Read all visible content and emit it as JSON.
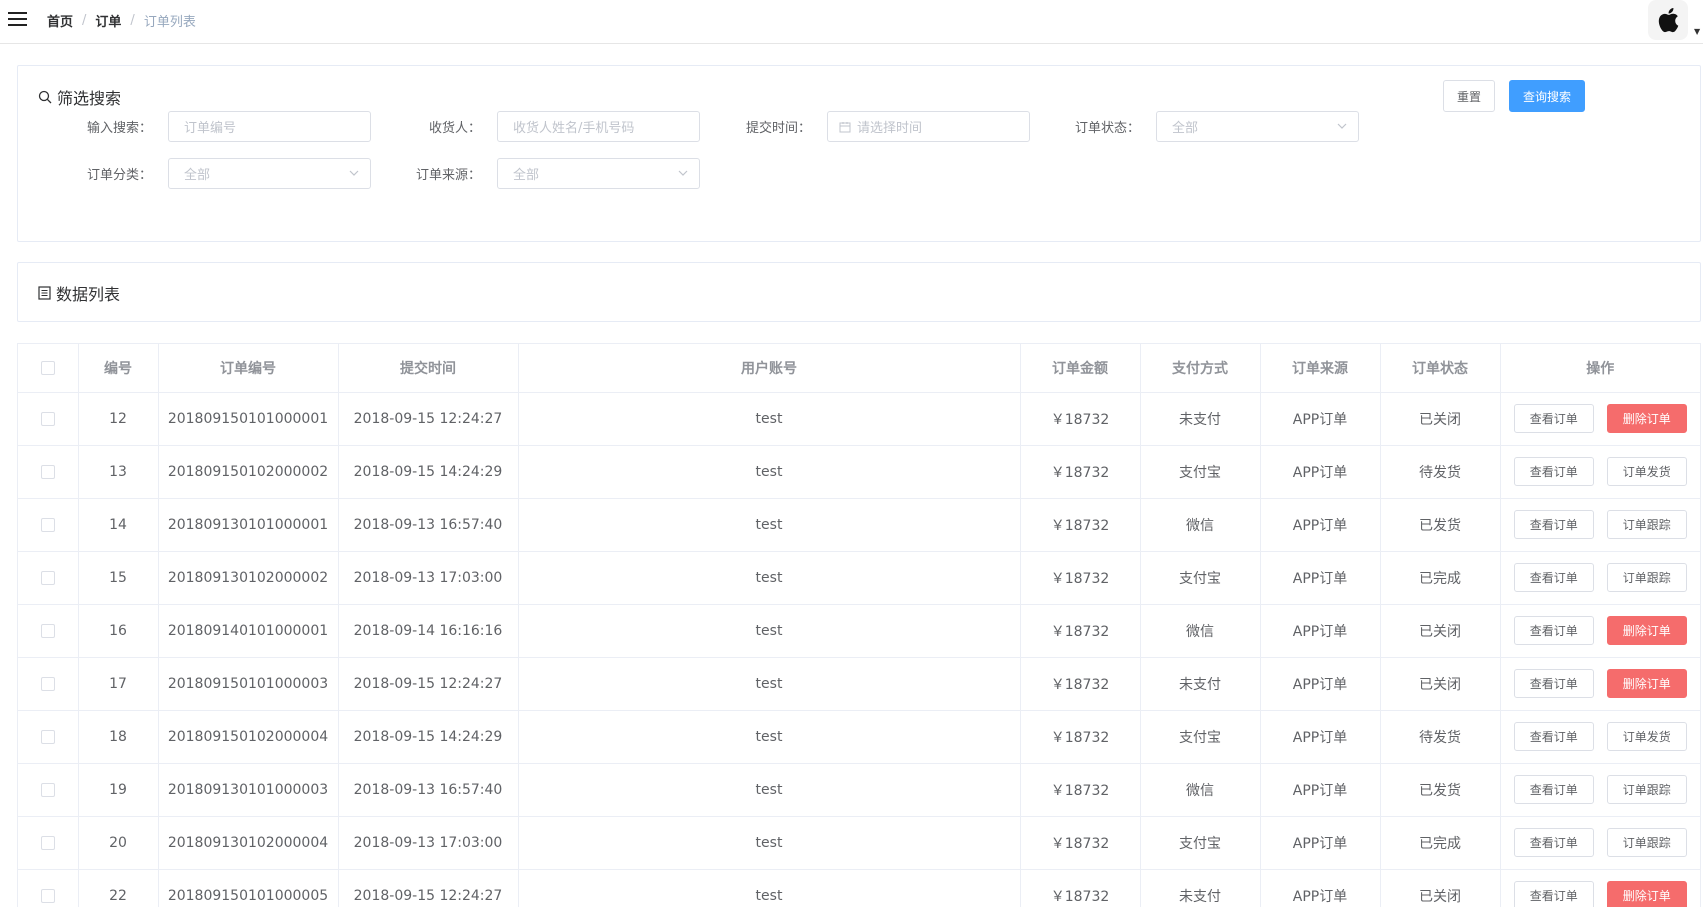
{
  "navbar": {
    "breadcrumb": [
      "首页",
      "订单",
      "订单列表"
    ],
    "separator": "/"
  },
  "filter": {
    "title": "筛选搜索",
    "reset_label": "重置",
    "search_label": "查询搜索",
    "fields": {
      "keyword": {
        "label": "输入搜索：",
        "placeholder": "订单编号"
      },
      "receiver": {
        "label": "收货人：",
        "placeholder": "收货人姓名/手机号码"
      },
      "submit_time": {
        "label": "提交时间：",
        "placeholder": "请选择时间"
      },
      "status": {
        "label": "订单状态：",
        "value": "全部"
      },
      "category": {
        "label": "订单分类：",
        "value": "全部"
      },
      "source": {
        "label": "订单来源：",
        "value": "全部"
      }
    }
  },
  "list": {
    "title": "数据列表"
  },
  "table": {
    "headers": [
      "编号",
      "订单编号",
      "提交时间",
      "用户账号",
      "订单金额",
      "支付方式",
      "订单来源",
      "订单状态",
      "操作"
    ],
    "rows": [
      {
        "id": "12",
        "order_no": "201809150101000001",
        "time": "2018-09-15 12:24:27",
        "user": "test",
        "amount": "￥18732",
        "pay": "未支付",
        "source": "APP订单",
        "status": "已关闭",
        "op1": "查看订单",
        "op2": "删除订单",
        "op2_type": "danger"
      },
      {
        "id": "13",
        "order_no": "201809150102000002",
        "time": "2018-09-15 14:24:29",
        "user": "test",
        "amount": "￥18732",
        "pay": "支付宝",
        "source": "APP订单",
        "status": "待发货",
        "op1": "查看订单",
        "op2": "订单发货",
        "op2_type": "default"
      },
      {
        "id": "14",
        "order_no": "201809130101000001",
        "time": "2018-09-13 16:57:40",
        "user": "test",
        "amount": "￥18732",
        "pay": "微信",
        "source": "APP订单",
        "status": "已发货",
        "op1": "查看订单",
        "op2": "订单跟踪",
        "op2_type": "default"
      },
      {
        "id": "15",
        "order_no": "201809130102000002",
        "time": "2018-09-13 17:03:00",
        "user": "test",
        "amount": "￥18732",
        "pay": "支付宝",
        "source": "APP订单",
        "status": "已完成",
        "op1": "查看订单",
        "op2": "订单跟踪",
        "op2_type": "default"
      },
      {
        "id": "16",
        "order_no": "201809140101000001",
        "time": "2018-09-14 16:16:16",
        "user": "test",
        "amount": "￥18732",
        "pay": "微信",
        "source": "APP订单",
        "status": "已关闭",
        "op1": "查看订单",
        "op2": "删除订单",
        "op2_type": "danger"
      },
      {
        "id": "17",
        "order_no": "201809150101000003",
        "time": "2018-09-15 12:24:27",
        "user": "test",
        "amount": "￥18732",
        "pay": "未支付",
        "source": "APP订单",
        "status": "已关闭",
        "op1": "查看订单",
        "op2": "删除订单",
        "op2_type": "danger"
      },
      {
        "id": "18",
        "order_no": "201809150102000004",
        "time": "2018-09-15 14:24:29",
        "user": "test",
        "amount": "￥18732",
        "pay": "支付宝",
        "source": "APP订单",
        "status": "待发货",
        "op1": "查看订单",
        "op2": "订单发货",
        "op2_type": "default"
      },
      {
        "id": "19",
        "order_no": "201809130101000003",
        "time": "2018-09-13 16:57:40",
        "user": "test",
        "amount": "￥18732",
        "pay": "微信",
        "source": "APP订单",
        "status": "已发货",
        "op1": "查看订单",
        "op2": "订单跟踪",
        "op2_type": "default"
      },
      {
        "id": "20",
        "order_no": "201809130102000004",
        "time": "2018-09-13 17:03:00",
        "user": "test",
        "amount": "￥18732",
        "pay": "支付宝",
        "source": "APP订单",
        "status": "已完成",
        "op1": "查看订单",
        "op2": "订单跟踪",
        "op2_type": "default"
      },
      {
        "id": "22",
        "order_no": "201809150101000005",
        "time": "2018-09-15 12:24:27",
        "user": "test",
        "amount": "￥18732",
        "pay": "未支付",
        "source": "APP订单",
        "status": "已关闭",
        "op1": "查看订单",
        "op2": "删除订单",
        "op2_type": "danger"
      }
    ]
  },
  "colors": {
    "primary": "#409eff",
    "danger": "#f56c6c",
    "border": "#ebeef5"
  },
  "icons": [
    "hamburger-icon",
    "apple-logo-icon",
    "search-icon",
    "list-icon",
    "calendar-icon",
    "chevron-down-icon"
  ]
}
